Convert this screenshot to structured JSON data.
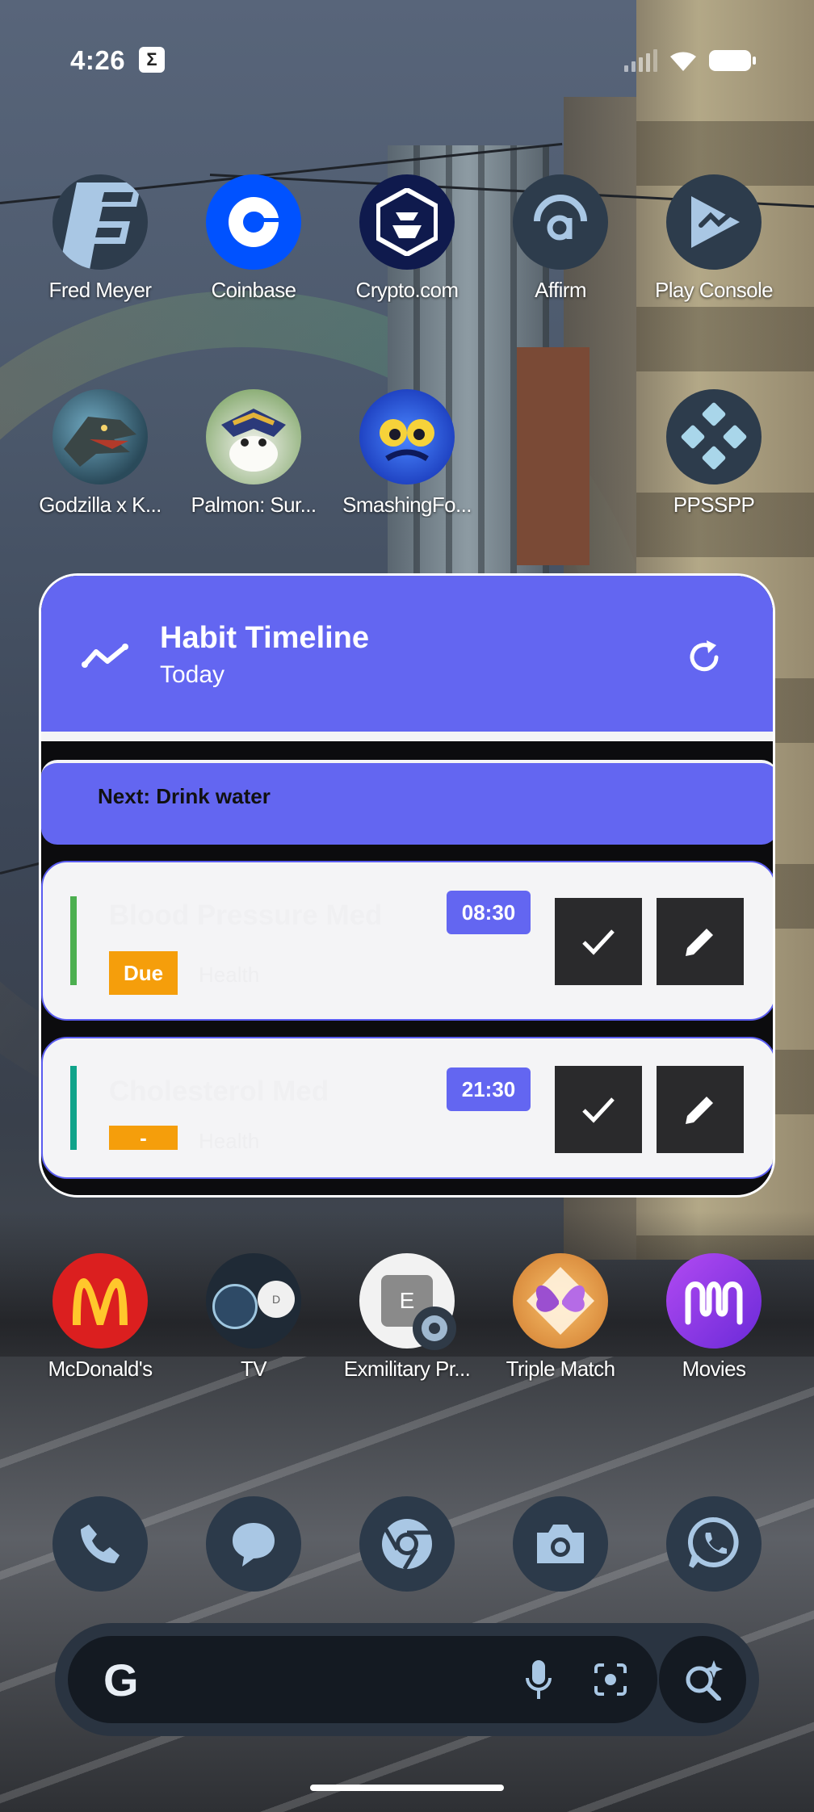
{
  "status_bar": {
    "time": "4:26",
    "notification_icon": "Σ"
  },
  "home_row_1": [
    {
      "label": "Fred Meyer",
      "icon": "fred-meyer-icon",
      "bg": "#2d3c4c"
    },
    {
      "label": "Coinbase",
      "icon": "coinbase-icon",
      "bg": "#0052ff"
    },
    {
      "label": "Crypto.com",
      "icon": "crypto-com-icon",
      "bg": "#0f1a4d"
    },
    {
      "label": "Affirm",
      "icon": "affirm-icon",
      "bg": "#2d3c4c"
    },
    {
      "label": "Play Console",
      "icon": "play-console-icon",
      "bg": "#2d3c4c"
    }
  ],
  "home_row_2": [
    {
      "label": "Godzilla x K...",
      "icon": "godzilla-icon"
    },
    {
      "label": "Palmon: Sur...",
      "icon": "palmon-icon"
    },
    {
      "label": "SmashingFo...",
      "icon": "smashing-four-icon"
    },
    {
      "label": "PPSSPP",
      "icon": "ppsspp-icon"
    }
  ],
  "widget": {
    "title": "Habit Timeline",
    "subtitle": "Today",
    "next_label": "Next: Drink water",
    "habits": [
      {
        "name": "Blood Pressure Med",
        "time": "08:30",
        "status": "Due",
        "category": "Health",
        "accent": "#4caf50"
      },
      {
        "name": "Cholesterol Med",
        "time": "21:30",
        "status": "-",
        "category": "Health",
        "accent": "#10a38a"
      }
    ],
    "accent_color": "#6366f1"
  },
  "home_row_3": [
    {
      "label": "McDonald's",
      "icon": "mcdonalds-icon"
    },
    {
      "label": "TV",
      "icon": "tv-folder-icon"
    },
    {
      "label": "Exmilitary Pr...",
      "icon": "exmilitary-icon"
    },
    {
      "label": "Triple Match",
      "icon": "triple-match-icon"
    },
    {
      "label": "Movies",
      "icon": "movies-icon"
    }
  ],
  "dock": [
    {
      "icon": "phone-icon"
    },
    {
      "icon": "messages-icon"
    },
    {
      "icon": "chrome-icon"
    },
    {
      "icon": "camera-icon"
    },
    {
      "icon": "whatsapp-icon"
    }
  ],
  "search": {
    "logo": "G"
  }
}
